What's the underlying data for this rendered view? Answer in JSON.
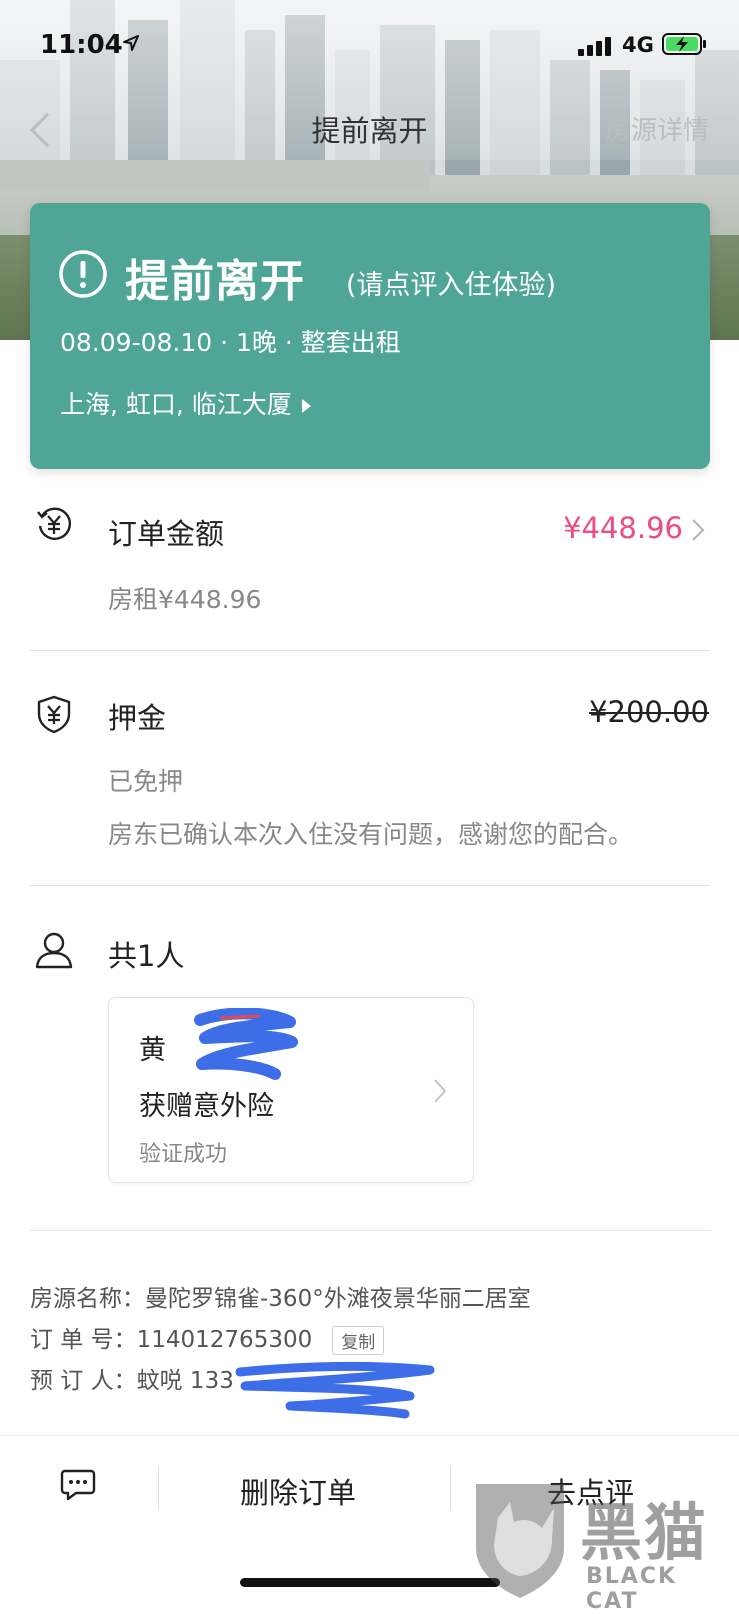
{
  "status_bar": {
    "time": "11:04",
    "network": "4G"
  },
  "nav": {
    "title": "提前离开",
    "right_link": "房源详情"
  },
  "order_card": {
    "status": "提前离开",
    "hint": "(请点评入住体验)",
    "dates": "08.09-08.10 · 1晚 · 整套出租",
    "address": "上海, 虹口, 临江大厦",
    "color": "#4fa596"
  },
  "payment": {
    "label": "订单金额",
    "amount": "¥448.96",
    "amount_color": "#ec4b84",
    "detail": "房租¥448.96"
  },
  "deposit": {
    "label": "押金",
    "amount": "¥200.00",
    "status": "已免押",
    "note": "房东已确认本次入住没有问题，感谢您的配合。"
  },
  "guests": {
    "label": "共1人",
    "card": {
      "name": "黄",
      "insurance": "获赠意外险",
      "verification": "验证成功"
    }
  },
  "listing_info": {
    "name_line": "房源名称：曼陀罗锦雀-360°外滩夜景华丽二居室",
    "order_line": "订  单  号：114012765300",
    "copy_label": "复制",
    "booker_line": "预  订  人：蚊哾 133"
  },
  "bottom_bar": {
    "delete_label": "删除订单",
    "review_label": "去点评"
  },
  "watermark": {
    "text": "黑猫",
    "sub": "BLACK CAT"
  }
}
